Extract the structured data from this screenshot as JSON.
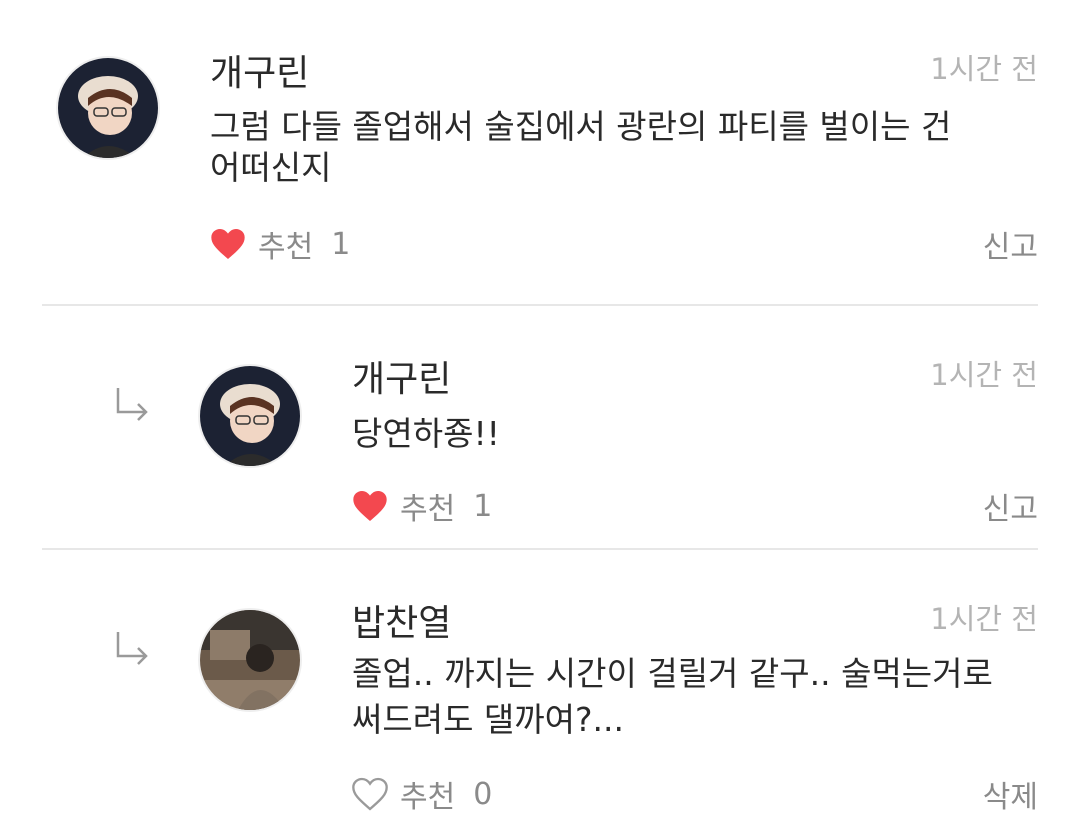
{
  "comments": [
    {
      "username": "개구린",
      "time": "1시간 전",
      "text_line1": "그럼 다들 졸업해서 술집에서 광란의 파티를 벌이는 건",
      "text_line2": "어떠신지",
      "like_label": "추천",
      "like_count": "1",
      "liked": true,
      "action": "신고"
    },
    {
      "username": "개구린",
      "time": "1시간 전",
      "text_line1": "당연하죵!!",
      "like_label": "추천",
      "like_count": "1",
      "liked": true,
      "action": "신고"
    },
    {
      "username": "밥찬열",
      "time": "1시간 전",
      "text_line1": "졸업.. 까지는 시간이 걸릴거 같구.. 술먹는거로",
      "text_line2": "써드려도 댈까여?...",
      "like_label": "추천",
      "like_count": "0",
      "liked": false,
      "action": "삭제"
    }
  ],
  "colors": {
    "heart_filled": "#f3484f",
    "heart_outline": "#9a9a9a",
    "meta_text": "#8a8a8a",
    "time_text": "#b4b4b4",
    "divider": "#e7e7e7"
  },
  "icons": {
    "reply": "reply-arrow-icon",
    "liked": "heart-filled-icon",
    "not_liked": "heart-outline-icon"
  }
}
